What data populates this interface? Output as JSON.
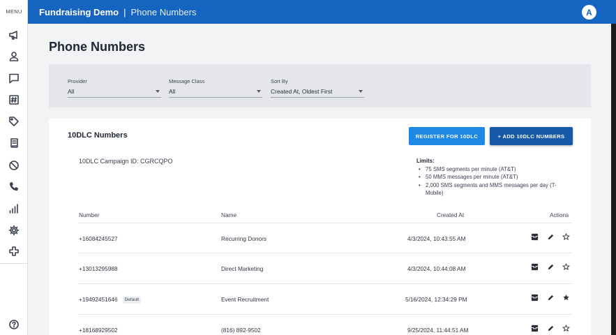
{
  "sidebar": {
    "menu_label": "MENU",
    "items": [
      {
        "icon": "megaphone-icon"
      },
      {
        "icon": "person-icon"
      },
      {
        "icon": "chat-icon"
      },
      {
        "icon": "hashtag-icon"
      },
      {
        "icon": "tag-icon"
      },
      {
        "icon": "script-icon"
      },
      {
        "icon": "block-icon"
      },
      {
        "icon": "phone-icon"
      },
      {
        "icon": "bar-chart-icon"
      },
      {
        "icon": "gear-icon"
      },
      {
        "icon": "plus-cross-icon"
      }
    ],
    "help_icon": "help-icon"
  },
  "topbar": {
    "org_name": "Fundraising Demo",
    "separator": "|",
    "breadcrumb": "Phone Numbers",
    "avatar_initial": "A",
    "color": "#1565c0"
  },
  "page": {
    "title": "Phone Numbers"
  },
  "filters": {
    "provider": {
      "label": "Provider",
      "value": "All"
    },
    "message_class": {
      "label": "Message Class",
      "value": "All"
    },
    "sort_by": {
      "label": "Sort By",
      "value": "Created At, Oldest First"
    }
  },
  "tendlc": {
    "title": "10DLC Numbers",
    "register_button": "REGISTER FOR 10DLC",
    "add_button": "+ ADD 10DLC NUMBERS",
    "campaign_id": "10DLC Campaign ID: CGRCQPO",
    "limits_title": "Limits:",
    "limits": [
      "75 SMS segments per minute (AT&T)",
      "50 MMS messages per minute (AT&T)",
      "2,000 SMS segments and MMS messages per day (T-Mobile)"
    ]
  },
  "table": {
    "headers": {
      "number": "Number",
      "name": "Name",
      "created_at": "Created At",
      "actions": "Actions"
    },
    "rows": [
      {
        "number": "+16084245527",
        "badge": "",
        "name": "Recurring Donors",
        "created_at": "4/3/2024, 10:43:55 AM",
        "starred": false
      },
      {
        "number": "+13013295988",
        "badge": "",
        "name": "Direct Marketing",
        "created_at": "4/3/2024, 10:44:08 AM",
        "starred": false
      },
      {
        "number": "+19492451646",
        "badge": "Default",
        "name": "Event Recruitment",
        "created_at": "5/16/2024, 12:34:29 PM",
        "starred": true
      },
      {
        "number": "+18168929502",
        "badge": "",
        "name": "(816) 892-9502",
        "created_at": "9/25/2024, 11:44:51 AM",
        "starred": false
      }
    ]
  },
  "colors": {
    "primary": "#1565c0",
    "register_button": "#1e88e5",
    "add_button": "#1659a8"
  }
}
